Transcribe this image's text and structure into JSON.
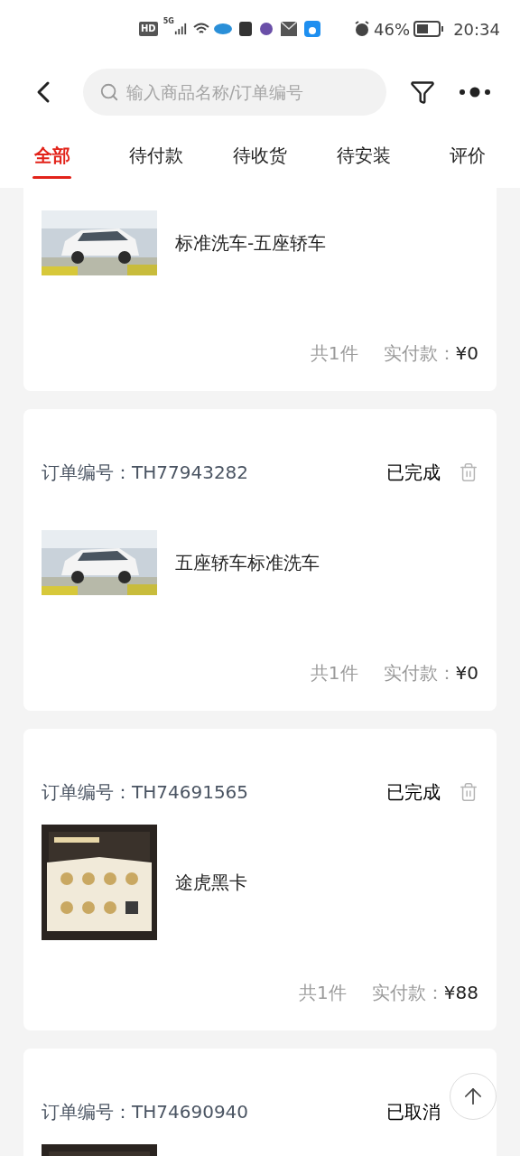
{
  "status_bar": {
    "hd": "HD",
    "network": "5G",
    "battery": "46%",
    "time": "20:34"
  },
  "header": {
    "search": {
      "placeholder": "输入商品名称/订单编号"
    }
  },
  "tabs": [
    {
      "label": "全部",
      "selected": true
    },
    {
      "label": "待付款",
      "selected": false
    },
    {
      "label": "待收货",
      "selected": false
    },
    {
      "label": "待安装",
      "selected": false
    },
    {
      "label": "评价",
      "selected": false
    }
  ],
  "orders": [
    {
      "product": {
        "name": "标准洗车-五座轿车"
      },
      "count": "共1件",
      "paid_label": "实付款：",
      "paid": "¥0"
    },
    {
      "order_no_label": "订单编号：",
      "order_no": "TH77943282",
      "status": "已完成",
      "product": {
        "name": "五座轿车标准洗车"
      },
      "count": "共1件",
      "paid_label": "实付款：",
      "paid": "¥0"
    },
    {
      "order_no_label": "订单编号：",
      "order_no": "TH74691565",
      "status": "已完成",
      "product": {
        "name": "途虎黑卡"
      },
      "count": "共1件",
      "paid_label": "实付款：",
      "paid": "¥88"
    },
    {
      "order_no_label": "订单编号：",
      "order_no": "TH74690940",
      "status": "已取消"
    }
  ]
}
